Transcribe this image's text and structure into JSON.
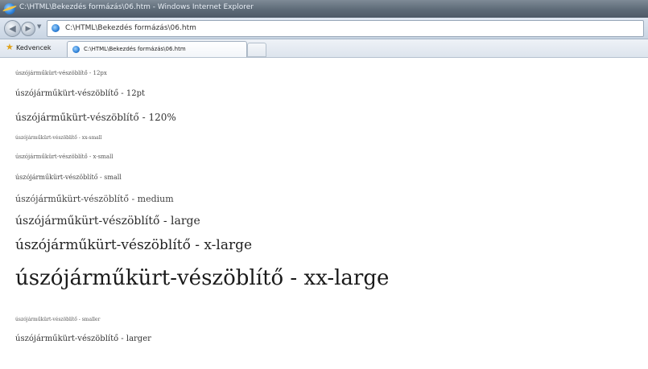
{
  "window": {
    "title": "C:\\HTML\\Bekezdés formázás\\06.htm - Windows Internet Explorer"
  },
  "address_bar": {
    "url": "C:\\HTML\\Bekezdés formázás\\06.htm"
  },
  "favorites_bar": {
    "favorites_label": "Kedvencek",
    "tab_label": "C:\\HTML\\Bekezdés formázás\\06.htm"
  },
  "content": {
    "lines": [
      "úszójárműkürt-vészöblítő - 12px",
      "úszójárműkürt-vészöblítő - 12pt",
      "úszójárműkürt-vészöblítő - 120%",
      "úszójárműkürt-vészöblítő - xx-small",
      "úszójárműkürt-vészöblítő - x-small",
      "úszójárműkürt-vészöblítő - small",
      "úszójárműkürt-vészöblítő - medium",
      "úszójárműkürt-vészöblítő - large",
      "úszójárműkürt-vészöblítő - x-large",
      "úszójárműkürt-vészöblítő - xx-large",
      "úszójárműkürt-vészöblítő - smaller",
      "úszójárműkürt-vészöblítő - larger"
    ]
  }
}
